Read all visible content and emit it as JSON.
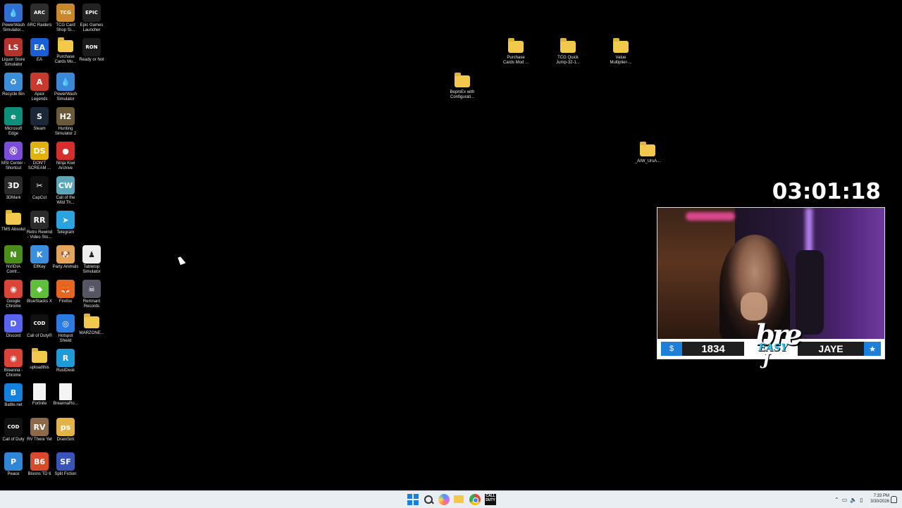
{
  "desktop": {
    "icons": [
      {
        "label": "PowerWash Simulator...",
        "kind": "app",
        "color": "#2f6fd1",
        "glyph": "💧",
        "col": 0,
        "row": 0
      },
      {
        "label": "ARC Raiders",
        "kind": "app",
        "color": "#2d2d2d",
        "glyph": "ARC",
        "col": 1,
        "row": 0
      },
      {
        "label": "TCG Card Shop Si...",
        "kind": "app",
        "color": "#c9892b",
        "glyph": "TCG",
        "col": 2,
        "row": 0
      },
      {
        "label": "Epic Games Launcher",
        "kind": "app",
        "color": "#222222",
        "glyph": "EPIC",
        "col": 3,
        "row": 0
      },
      {
        "label": "Liquor Store Simulator",
        "kind": "app",
        "color": "#b5332b",
        "glyph": "LS",
        "col": 0,
        "row": 1
      },
      {
        "label": "EA",
        "kind": "app",
        "color": "#1a5fd6",
        "glyph": "EA",
        "col": 1,
        "row": 1
      },
      {
        "label": "Purchase Cards Mo...",
        "kind": "folder",
        "col": 2,
        "row": 1
      },
      {
        "label": "Ready or Not",
        "kind": "app",
        "color": "#1b1b1b",
        "glyph": "RON",
        "col": 3,
        "row": 1
      },
      {
        "label": "Recycle Bin",
        "kind": "app",
        "color": "#3a8fd8",
        "glyph": "♻",
        "col": 0,
        "row": 2
      },
      {
        "label": "Apex Legends",
        "kind": "app",
        "color": "#c93a2e",
        "glyph": "A",
        "col": 1,
        "row": 2
      },
      {
        "label": "PowerWash Simulator",
        "kind": "app",
        "color": "#3b88d9",
        "glyph": "💧",
        "col": 2,
        "row": 2
      },
      {
        "label": "Microsoft Edge",
        "kind": "app",
        "color": "#0e8f7a",
        "glyph": "e",
        "col": 0,
        "row": 3
      },
      {
        "label": "Steam",
        "kind": "app",
        "color": "#1b2838",
        "glyph": "S",
        "col": 1,
        "row": 3
      },
      {
        "label": "Hunting Simulator 2",
        "kind": "app",
        "color": "#6b5a3a",
        "glyph": "H2",
        "col": 2,
        "row": 3
      },
      {
        "label": "MSI Center - Shortcut",
        "kind": "app",
        "color": "#7c4dd6",
        "glyph": "Ⓠ",
        "col": 0,
        "row": 4
      },
      {
        "label": "DON'T SCREAM ...",
        "kind": "app",
        "color": "#e1b10e",
        "glyph": "DS",
        "col": 1,
        "row": 4
      },
      {
        "label": "Ninja Kiwi Archive",
        "kind": "app",
        "color": "#d62d2d",
        "glyph": "●",
        "col": 2,
        "row": 4
      },
      {
        "label": "3DMark",
        "kind": "app",
        "color": "#2a2a2a",
        "glyph": "3D",
        "col": 0,
        "row": 5
      },
      {
        "label": "CapCut",
        "kind": "app",
        "color": "#111111",
        "glyph": "✂",
        "col": 1,
        "row": 5
      },
      {
        "label": "Call of the Wild Th...",
        "kind": "app",
        "color": "#5aa7b8",
        "glyph": "CW",
        "col": 2,
        "row": 5
      },
      {
        "label": "TMS Absolut",
        "kind": "folder",
        "col": 0,
        "row": 6
      },
      {
        "label": "Retro Rewind - Video Sto...",
        "kind": "app",
        "color": "#2b2b2b",
        "glyph": "RR",
        "col": 1,
        "row": 6
      },
      {
        "label": "Telegram",
        "kind": "app",
        "color": "#2aa3e0",
        "glyph": "➤",
        "col": 2,
        "row": 6
      },
      {
        "label": "NVIDIA Contr...",
        "kind": "app",
        "color": "#4a8f1c",
        "glyph": "N",
        "col": 0,
        "row": 7
      },
      {
        "label": "ElfKey",
        "kind": "app",
        "color": "#3b8ee0",
        "glyph": "K",
        "col": 1,
        "row": 7
      },
      {
        "label": "Party Animals",
        "kind": "app",
        "color": "#e3a55b",
        "glyph": "🐶",
        "col": 2,
        "row": 7
      },
      {
        "label": "Tabletop Simulator",
        "kind": "app",
        "color": "#eeeeee",
        "glyph": "♟",
        "col": 3,
        "row": 7
      },
      {
        "label": "Google Chrome",
        "kind": "app",
        "color": "#db4437",
        "glyph": "◉",
        "col": 0,
        "row": 8
      },
      {
        "label": "BlueStacks X",
        "kind": "app",
        "color": "#5fbf3a",
        "glyph": "◆",
        "col": 1,
        "row": 8
      },
      {
        "label": "Firefox",
        "kind": "app",
        "color": "#e8651f",
        "glyph": "🦊",
        "col": 2,
        "row": 8
      },
      {
        "label": "Remnant Records",
        "kind": "app",
        "color": "#555566",
        "glyph": "☠",
        "col": 3,
        "row": 8
      },
      {
        "label": "Discord",
        "kind": "app",
        "color": "#5865f2",
        "glyph": "D",
        "col": 0,
        "row": 9
      },
      {
        "label": "Call of Duty®",
        "kind": "app",
        "color": "#111111",
        "glyph": "COD",
        "col": 1,
        "row": 9
      },
      {
        "label": "Hotspot Shield",
        "kind": "app",
        "color": "#2c7be5",
        "glyph": "◎",
        "col": 2,
        "row": 9
      },
      {
        "label": "WARZONE...",
        "kind": "folder",
        "col": 3,
        "row": 9
      },
      {
        "label": "Breanna - Chrome",
        "kind": "app",
        "color": "#db4437",
        "glyph": "◉",
        "col": 0,
        "row": 10
      },
      {
        "label": "uploadthis",
        "kind": "folder",
        "col": 1,
        "row": 10
      },
      {
        "label": "RustDesk",
        "kind": "app",
        "color": "#1e9bd7",
        "glyph": "R",
        "col": 2,
        "row": 10
      },
      {
        "label": "Battle.net",
        "kind": "app",
        "color": "#1482dc",
        "glyph": "B",
        "col": 0,
        "row": 11
      },
      {
        "label": "Fortnite",
        "kind": "file",
        "col": 1,
        "row": 11
      },
      {
        "label": "BreannaRo...",
        "kind": "file",
        "col": 2,
        "row": 11
      },
      {
        "label": "Call of Duty",
        "kind": "app",
        "color": "#111111",
        "glyph": "COD",
        "col": 0,
        "row": 12
      },
      {
        "label": "RV There Yet",
        "kind": "app",
        "color": "#8d6b4a",
        "glyph": "RV",
        "col": 1,
        "row": 12
      },
      {
        "label": "DrainSim",
        "kind": "app",
        "color": "#e3b24a",
        "glyph": "ps",
        "col": 2,
        "row": 12
      },
      {
        "label": "Peace",
        "kind": "app",
        "color": "#2f86d6",
        "glyph": "P",
        "col": 0,
        "row": 13
      },
      {
        "label": "Bloons TD 6",
        "kind": "app",
        "color": "#d84a2a",
        "glyph": "B6",
        "col": 1,
        "row": 13
      },
      {
        "label": "Split Fiction",
        "kind": "app",
        "color": "#3a53b8",
        "glyph": "SF",
        "col": 2,
        "row": 13
      }
    ],
    "folders_right": [
      {
        "label": "Purchase Cards Mod ..."
      },
      {
        "label": "TCG Quick Jump-32-1..."
      },
      {
        "label": "Value Multiplier-..."
      },
      {
        "label": "BepInEx with Configurati..."
      },
      {
        "label": "_AIW_UrsA..."
      }
    ]
  },
  "overlay": {
    "timer": "03:01:18",
    "left_count": "1834",
    "left_badge_icon": "dollar-icon",
    "right_name": "JAYE",
    "right_badge_icon": "star-icon",
    "logo_main": "bre",
    "logo_sub": "EASY",
    "logo_tail": "J"
  },
  "taskbar": {
    "clock_time": "7:33 PM",
    "clock_date": "3/30/2026",
    "accent": "#1a7ee0"
  }
}
